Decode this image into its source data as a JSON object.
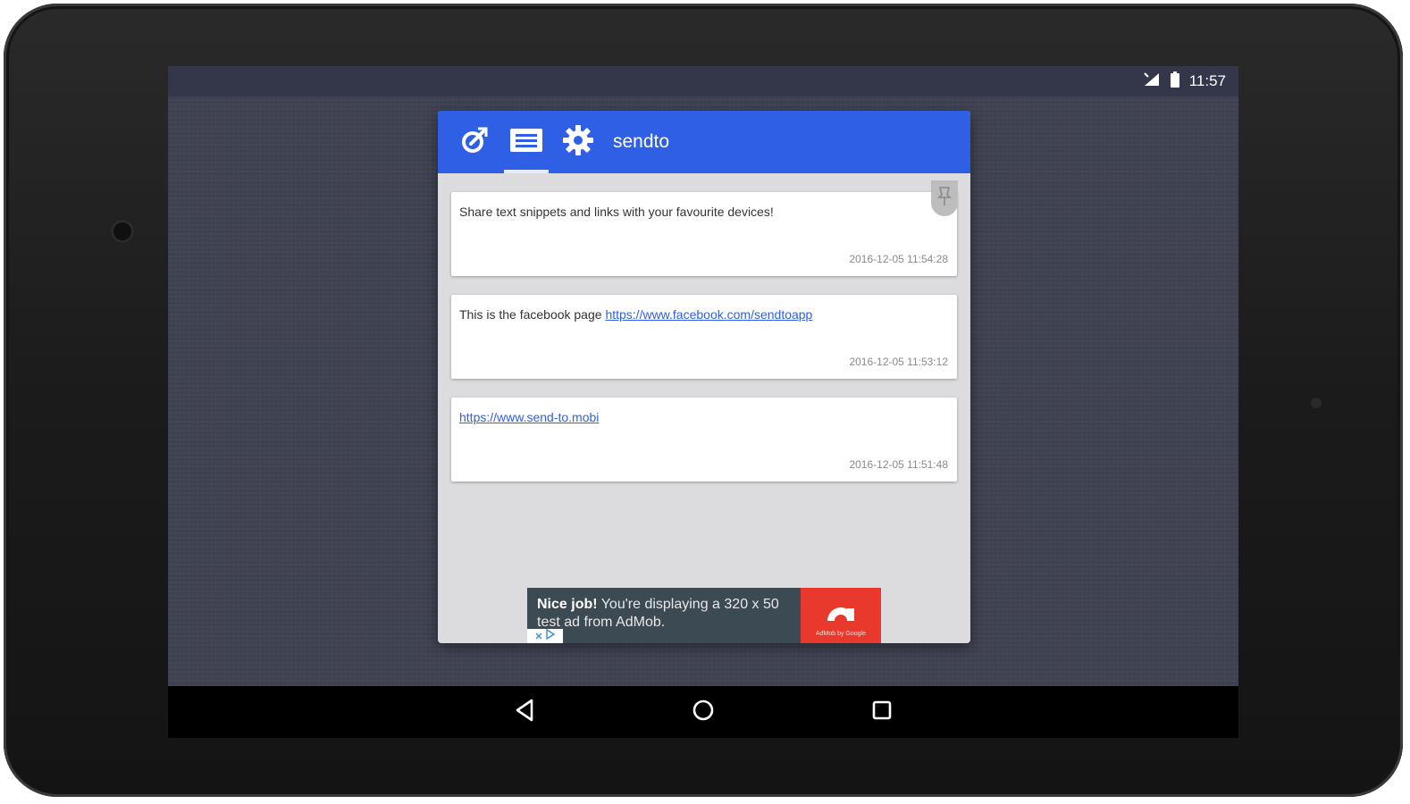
{
  "status_bar": {
    "time": "11:57"
  },
  "app": {
    "title": "sendto",
    "tabs": [
      {
        "name": "send",
        "icon": "send-icon"
      },
      {
        "name": "messages",
        "icon": "messages-icon",
        "active": true
      },
      {
        "name": "settings",
        "icon": "gear-icon"
      }
    ]
  },
  "messages": [
    {
      "text": "Share text snippets and links with your favourite devices!",
      "link": "",
      "timestamp": "2016-12-05 11:54:28",
      "pinned": true
    },
    {
      "text": "This is the facebook page ",
      "link": "https://www.facebook.com/sendtoapp",
      "timestamp": "2016-12-05 11:53:12"
    },
    {
      "text": "",
      "link": "https://www.send-to.mobi",
      "timestamp": "2016-12-05 11:51:48"
    }
  ],
  "ad": {
    "headline": "Nice job!",
    "body": " You're displaying a 320 x 50 test ad from AdMob.",
    "logo_caption": "AdMob by Google"
  },
  "colors": {
    "app_bar": "#2f5fe4",
    "background": "#3f4252",
    "ad_logo": "#e8392c"
  }
}
